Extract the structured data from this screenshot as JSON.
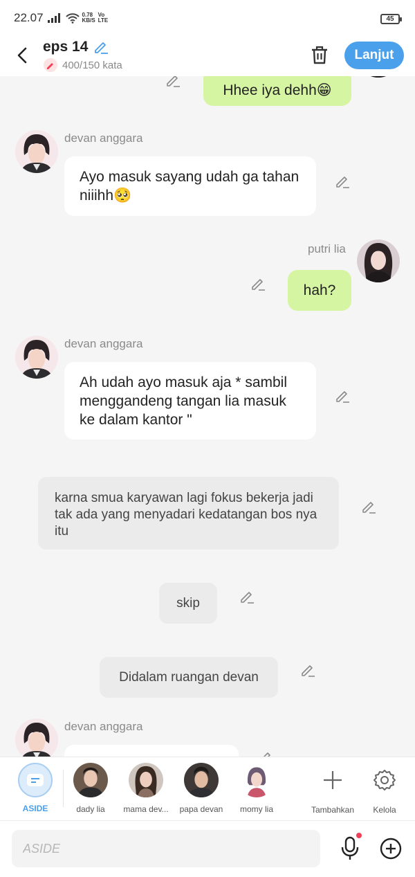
{
  "status_bar": {
    "time": "22.07",
    "net_speed": "0.78",
    "net_unit": "KB/S",
    "vo": "Vo",
    "lte": "LTE",
    "battery": "45"
  },
  "header": {
    "title": "eps 14",
    "word_count": "400/150 kata",
    "next_label": "Lanjut"
  },
  "messages": {
    "m0": {
      "text": "Hhee iya dehh😁"
    },
    "m1": {
      "name": "devan anggara",
      "text": "Ayo masuk sayang udah ga tahan niiihh🥺"
    },
    "m2": {
      "name": "putri lia",
      "text": "hah?"
    },
    "m3": {
      "name": "devan anggara",
      "text": "Ah udah ayo masuk aja * sambil menggandeng tangan lia masuk ke dalam kantor \""
    },
    "n1": {
      "text": "karna smua karyawan lagi fokus bekerja jadi tak ada yang menyadari kedatangan bos nya itu"
    },
    "n2": {
      "text": "skip"
    },
    "n3": {
      "text": "Didalam ruangan devan"
    },
    "m4": {
      "name": "devan anggara"
    }
  },
  "characters": [
    {
      "label": "ASIDE",
      "active": true
    },
    {
      "label": "dady lia"
    },
    {
      "label": "mama dev..."
    },
    {
      "label": "papa devan"
    },
    {
      "label": "momy lia"
    }
  ],
  "actions": {
    "add_label": "Tambahkan",
    "manage_label": "Kelola"
  },
  "input": {
    "placeholder": "ASIDE"
  },
  "colors": {
    "accent": "#4aa0ea",
    "outgoing_bubble": "#d6f5a3",
    "aside_label": "#4aa0ea"
  }
}
